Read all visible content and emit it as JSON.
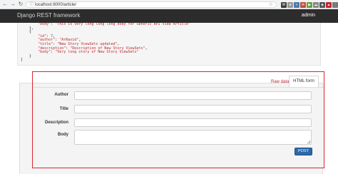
{
  "browser": {
    "url": "localhost:8000/article/",
    "back_glyph": "←",
    "forward_glyph": "→",
    "reload_glyph": "↻",
    "info_glyph": "ⓘ",
    "star_glyph": "☆",
    "extensions": [
      {
        "label": "W",
        "color": "#3b3b3b"
      },
      {
        "label": "●",
        "color": "#999999"
      },
      {
        "label": "▪",
        "color": "#4a7ab5"
      },
      {
        "label": "✉",
        "color": "#c44a3c"
      },
      {
        "label": "▶",
        "color": "#6a9e3a"
      },
      {
        "label": "☁",
        "color": "#888888"
      },
      {
        "label": "◈",
        "color": "#555555"
      },
      {
        "label": "▲",
        "color": "#c0272d"
      },
      {
        "label": "⋮",
        "color": "#777777"
      }
    ]
  },
  "navbar": {
    "brand": "Django REST framework",
    "user": "admin"
  },
  "code_lines": [
    [
      {
        "t": "        ",
        "c": "k"
      },
      {
        "t": "\"body\"",
        "c": "s"
      },
      {
        "t": ": ",
        "c": "k"
      },
      {
        "t": "\"This is very long long long body for Generic API View Article\"",
        "c": "s"
      }
    ],
    [
      {
        "t": "    },",
        "c": "k"
      }
    ],
    [
      {
        "t": "    {",
        "c": "k"
      }
    ],
    [
      {
        "t": "        ",
        "c": "k"
      },
      {
        "t": "\"id\"",
        "c": "s"
      },
      {
        "t": ": ",
        "c": "k"
      },
      {
        "t": "7",
        "c": "n"
      },
      {
        "t": ",",
        "c": "k"
      }
    ],
    [
      {
        "t": "        ",
        "c": "k"
      },
      {
        "t": "\"author\"",
        "c": "s"
      },
      {
        "t": ": ",
        "c": "k"
      },
      {
        "t": "\"ArRasid\"",
        "c": "s"
      },
      {
        "t": ",",
        "c": "k"
      }
    ],
    [
      {
        "t": "        ",
        "c": "k"
      },
      {
        "t": "\"title\"",
        "c": "s"
      },
      {
        "t": ": ",
        "c": "k"
      },
      {
        "t": "\"New Story ViewSets updated\"",
        "c": "s"
      },
      {
        "t": ",",
        "c": "k"
      }
    ],
    [
      {
        "t": "        ",
        "c": "k"
      },
      {
        "t": "\"description\"",
        "c": "s"
      },
      {
        "t": ": ",
        "c": "k"
      },
      {
        "t": "\"Description of New Story ViewSets\"",
        "c": "s"
      },
      {
        "t": ",",
        "c": "k"
      }
    ],
    [
      {
        "t": "        ",
        "c": "k"
      },
      {
        "t": "\"body\"",
        "c": "s"
      },
      {
        "t": ": ",
        "c": "k"
      },
      {
        "t": "\"Very long story of New Story ViewSets\"",
        "c": "s"
      }
    ],
    [
      {
        "t": "    }",
        "c": "k"
      }
    ],
    [
      {
        "t": "]",
        "c": "k"
      }
    ]
  ],
  "tabs": {
    "raw": "Raw data",
    "html": "HTML form"
  },
  "form": {
    "author_label": "Author",
    "author_value": "",
    "title_label": "Title",
    "title_value": "",
    "description_label": "Description",
    "description_value": "",
    "body_label": "Body",
    "body_value": "",
    "submit_label": "POST"
  }
}
